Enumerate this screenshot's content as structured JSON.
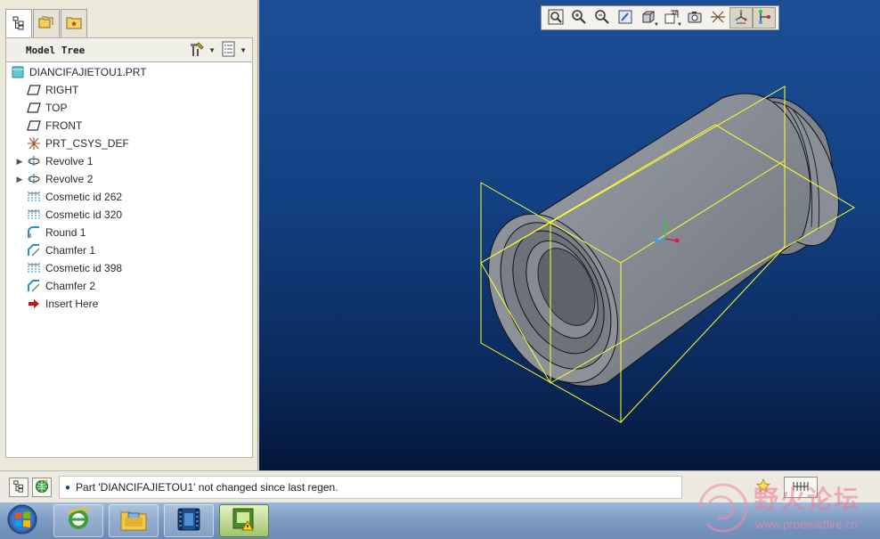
{
  "left_panel": {
    "tabs": [
      {
        "icon": "model-tree-icon"
      },
      {
        "icon": "folder-browser-icon"
      },
      {
        "icon": "favorites-icon"
      }
    ],
    "header": {
      "title": "Model Tree",
      "settings_icon": "tree-settings-icon",
      "show_icon": "tree-show-icon"
    },
    "tree": [
      {
        "label": "DIANCIFAJIETOU1.PRT",
        "icon": "part-icon",
        "expandable": false,
        "indent": 0
      },
      {
        "label": "RIGHT",
        "icon": "datum-plane-icon",
        "expandable": false,
        "indent": 1
      },
      {
        "label": "TOP",
        "icon": "datum-plane-icon",
        "expandable": false,
        "indent": 1
      },
      {
        "label": "FRONT",
        "icon": "datum-plane-icon",
        "expandable": false,
        "indent": 1
      },
      {
        "label": "PRT_CSYS_DEF",
        "icon": "csys-icon",
        "expandable": false,
        "indent": 1
      },
      {
        "label": "Revolve 1",
        "icon": "revolve-icon",
        "expandable": true,
        "indent": 1
      },
      {
        "label": "Revolve 2",
        "icon": "revolve-icon",
        "expandable": true,
        "indent": 1
      },
      {
        "label": "Cosmetic id 262",
        "icon": "cosmetic-thread-icon",
        "expandable": false,
        "indent": 1
      },
      {
        "label": "Cosmetic id 320",
        "icon": "cosmetic-thread-icon",
        "expandable": false,
        "indent": 1
      },
      {
        "label": "Round 1",
        "icon": "round-icon",
        "expandable": false,
        "indent": 1
      },
      {
        "label": "Chamfer 1",
        "icon": "chamfer-icon",
        "expandable": false,
        "indent": 1
      },
      {
        "label": "Cosmetic id 398",
        "icon": "cosmetic-thread-icon",
        "expandable": false,
        "indent": 1
      },
      {
        "label": "Chamfer 2",
        "icon": "chamfer-icon",
        "expandable": false,
        "indent": 1
      },
      {
        "label": "Insert Here",
        "icon": "insert-here-arrow-icon",
        "expandable": false,
        "indent": 1
      }
    ]
  },
  "view_toolbar": {
    "buttons": [
      {
        "icon": "refit-icon"
      },
      {
        "icon": "zoom-in-icon"
      },
      {
        "icon": "zoom-out-icon"
      },
      {
        "icon": "repaint-icon"
      },
      {
        "icon": "display-style-icon"
      },
      {
        "icon": "saved-views-icon"
      },
      {
        "icon": "view-manager-icon"
      },
      {
        "icon": "datum-display-icon"
      },
      {
        "icon": "spin-center-icon"
      },
      {
        "icon": "orient-mode-icon"
      }
    ]
  },
  "status_bar": {
    "message": "Part 'DIANCIFAJIETOU1' not changed since last regen."
  },
  "watermark": {
    "title": "野火论坛",
    "url": "www.proewildfire.cn"
  },
  "taskbar": {
    "apps": [
      {
        "icon": "start-button-icon"
      },
      {
        "icon": "internet-explorer-icon"
      },
      {
        "icon": "file-explorer-icon"
      },
      {
        "icon": "media-player-icon"
      },
      {
        "icon": "creo-app-icon"
      }
    ]
  },
  "colors": {
    "viewport_top": "#1c4f98",
    "viewport_bottom": "#04163a",
    "model_fill": "#8c9199",
    "datum_outline": "#ffff33"
  }
}
